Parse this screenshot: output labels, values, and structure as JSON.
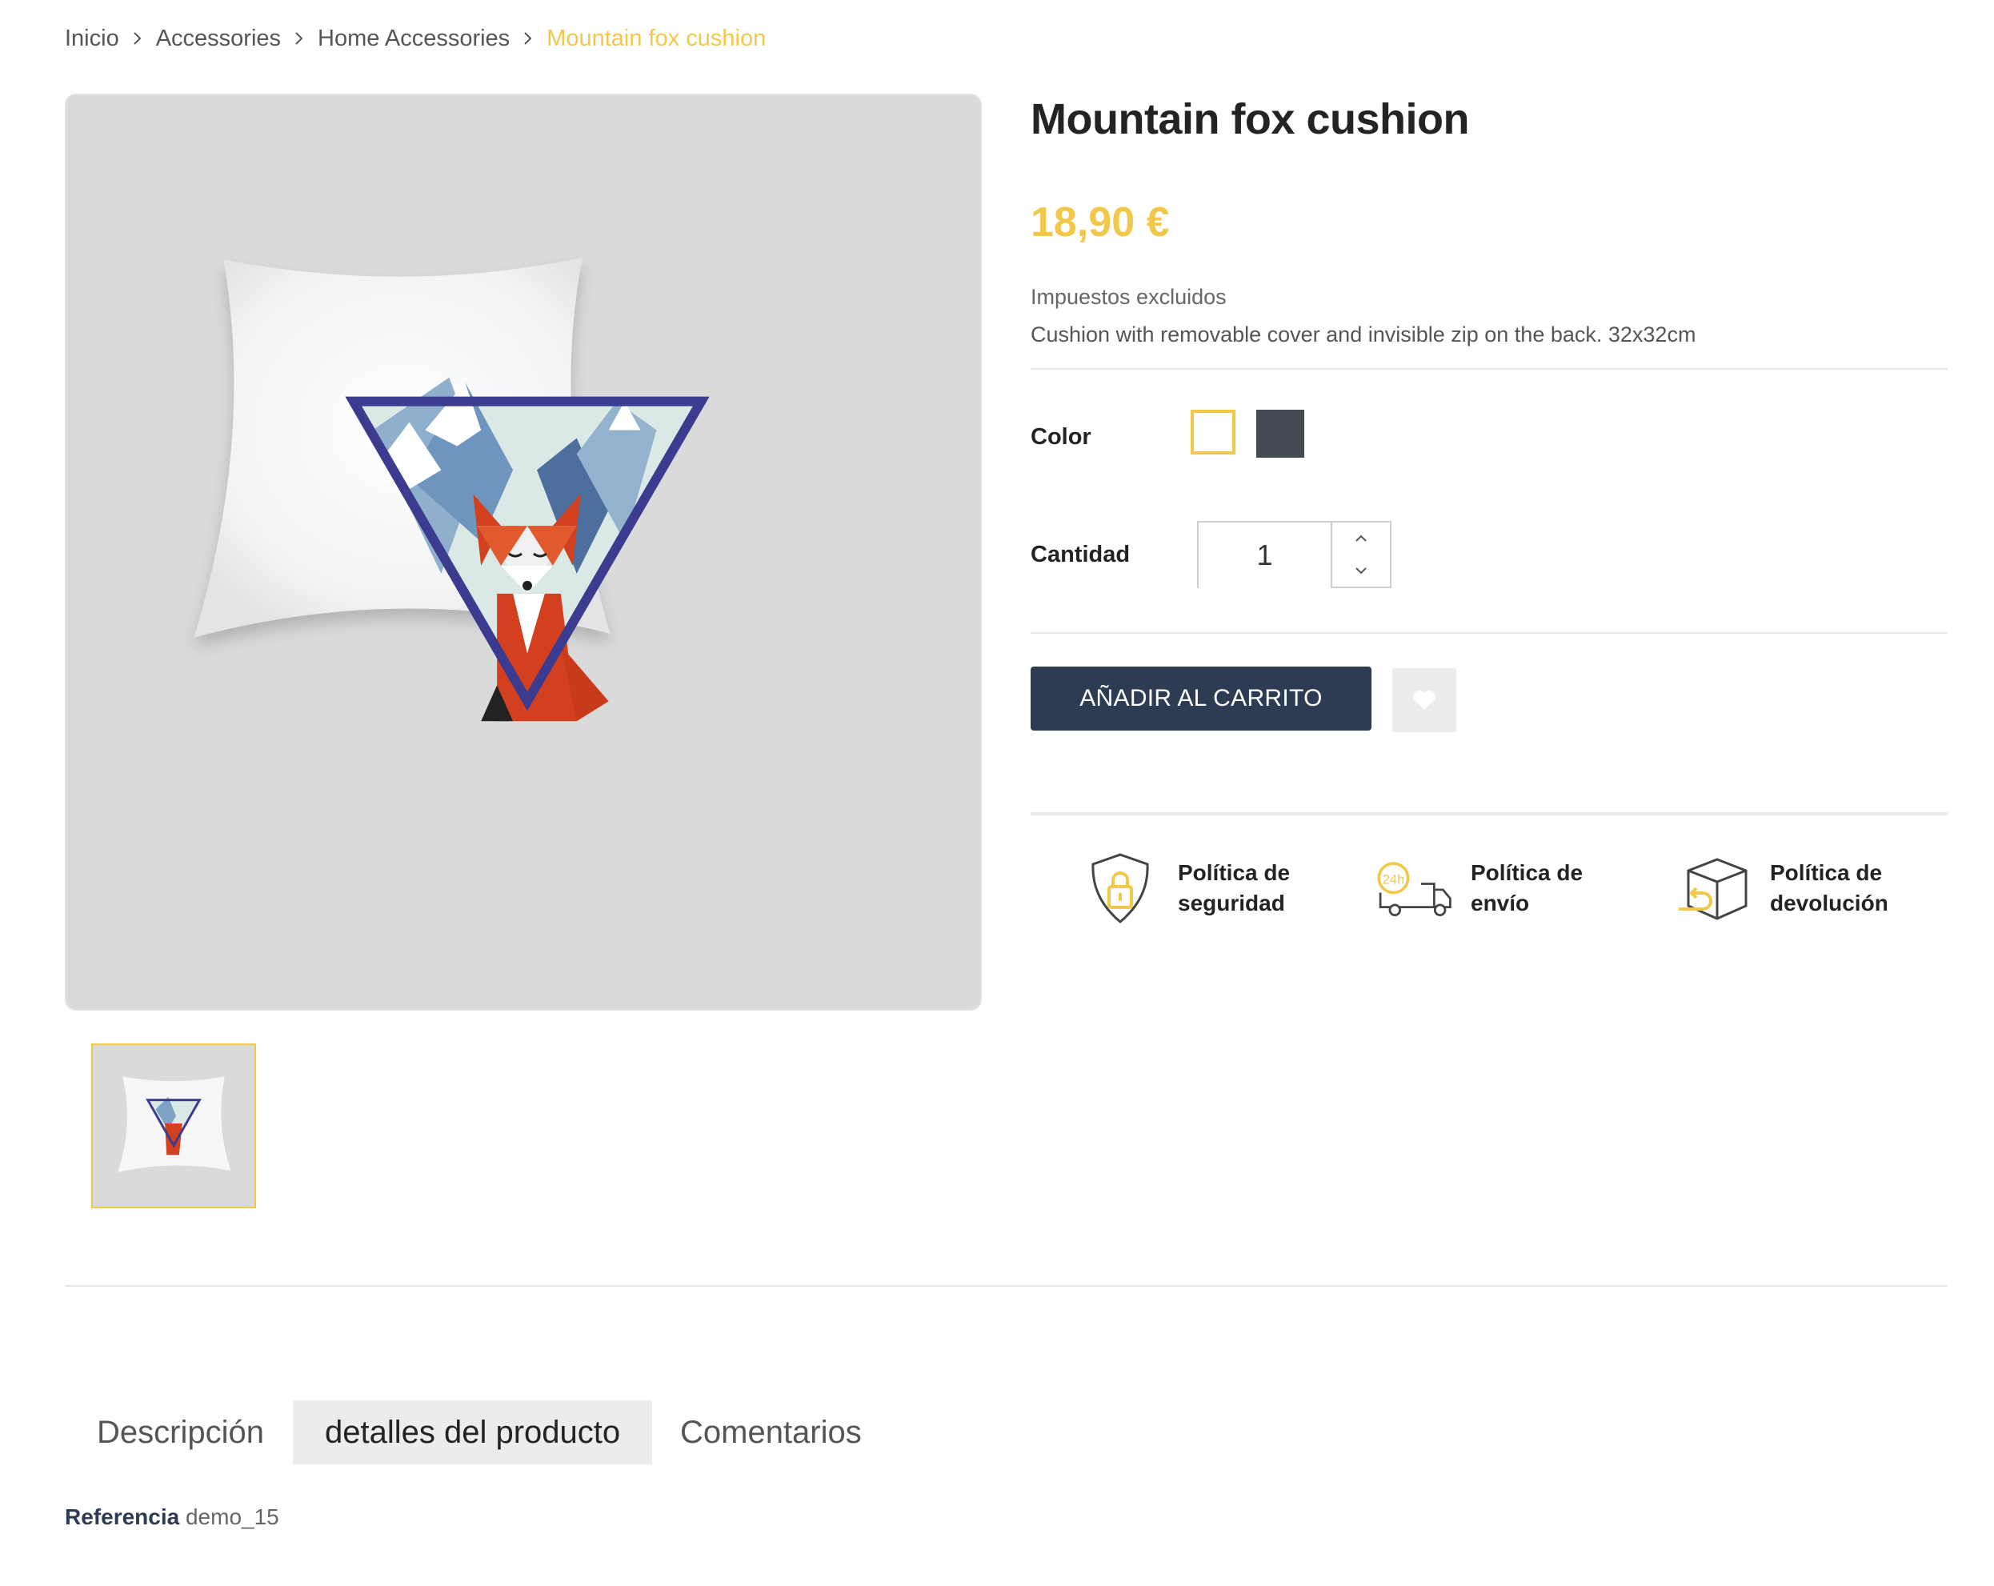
{
  "breadcrumb": {
    "items": [
      "Inicio",
      "Accessories",
      "Home Accessories"
    ],
    "current": "Mountain fox cushion",
    "separator_icon": "chevron-right-icon"
  },
  "product": {
    "title": "Mountain fox cushion",
    "price": "18,90 €",
    "tax_note": "Impuestos excluidos",
    "short_description": "Cushion with removable cover and invisible zip on the back. 32x32cm",
    "image_alt": "Mountain fox cushion"
  },
  "variants": {
    "color_label": "Color",
    "colors": [
      {
        "name": "White",
        "hex": "#ffffff",
        "selected": true
      },
      {
        "name": "Black",
        "hex": "#434a54",
        "selected": false
      }
    ]
  },
  "quantity": {
    "label": "Cantidad",
    "value": "1"
  },
  "actions": {
    "add_to_cart": "AÑADIR AL CARRITO",
    "wishlist_icon": "heart-icon"
  },
  "policies": [
    {
      "icon": "shield-lock-icon",
      "label": "Política de seguridad"
    },
    {
      "icon": "delivery-truck-24h-icon",
      "label": "Política de envío"
    },
    {
      "icon": "return-box-icon",
      "label": "Política de devolución"
    }
  ],
  "tabs": [
    {
      "label": "Descripción",
      "active": false
    },
    {
      "label": "detalles del producto",
      "active": true
    },
    {
      "label": "Comentarios",
      "active": false
    }
  ],
  "details": {
    "reference_label": "Referencia",
    "reference_value": "demo_15"
  },
  "colors": {
    "accent": "#f2c84b",
    "button_primary": "#2d3c52",
    "text": "#232323"
  }
}
